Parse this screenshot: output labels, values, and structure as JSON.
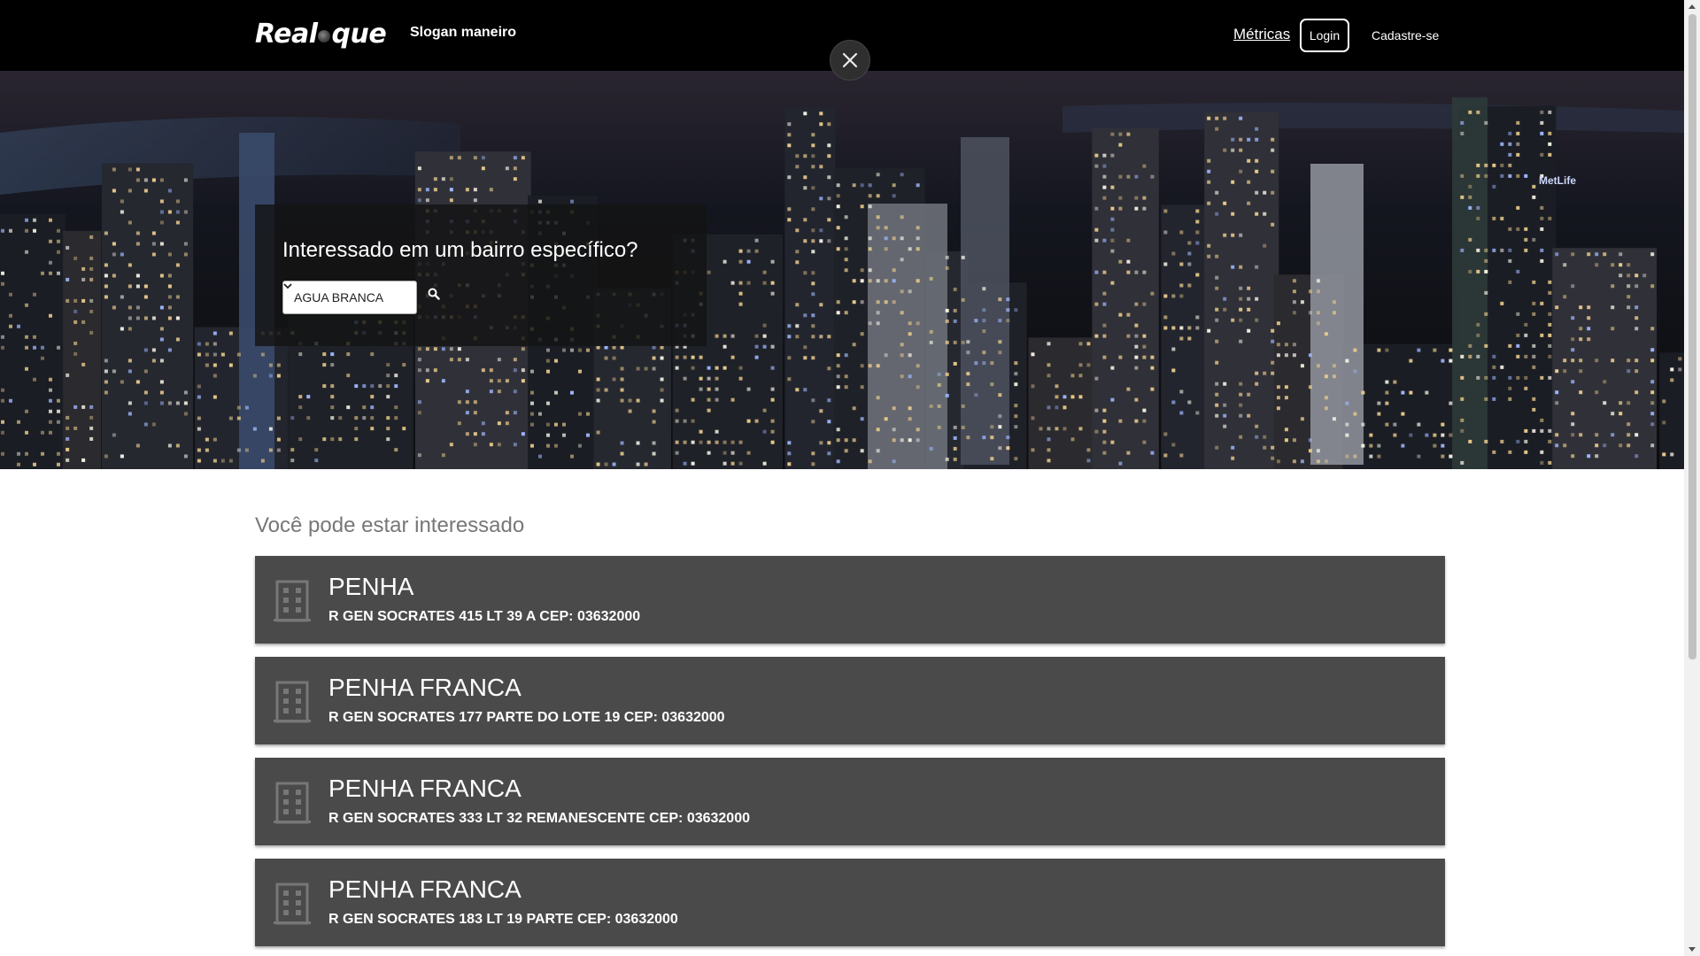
{
  "header": {
    "brand_left": "Real",
    "brand_right": "que",
    "slogan": "Slogan maneiro",
    "nav": {
      "metricas": "Métricas",
      "login": "Login",
      "cadastre": "Cadastre-se"
    },
    "close_icon": "close-icon"
  },
  "hero": {
    "search_title": "Interessado em um bairro específico?",
    "select_value": "AGUA BRANCA",
    "search_icon": "search-icon",
    "skyline_sign": "MetLife"
  },
  "suggestions": {
    "title": "Você pode estar interessado",
    "items": [
      {
        "name": "PENHA",
        "address": "R GEN SOCRATES 415 LT 39 A CEP: 03632000"
      },
      {
        "name": "PENHA FRANCA",
        "address": "R GEN SOCRATES 177 PARTE DO LOTE 19 CEP: 03632000"
      },
      {
        "name": "PENHA FRANCA",
        "address": "R GEN SOCRATES 333 LT 32 REMANESCENTE CEP: 03632000"
      },
      {
        "name": "PENHA FRANCA",
        "address": "R GEN SOCRATES 183 LT 19 PARTE CEP: 03632000"
      }
    ],
    "item_icon": "building-icon"
  },
  "colors": {
    "topbar": "#000000",
    "card": "#4a4a4a",
    "section_title": "#777777"
  }
}
